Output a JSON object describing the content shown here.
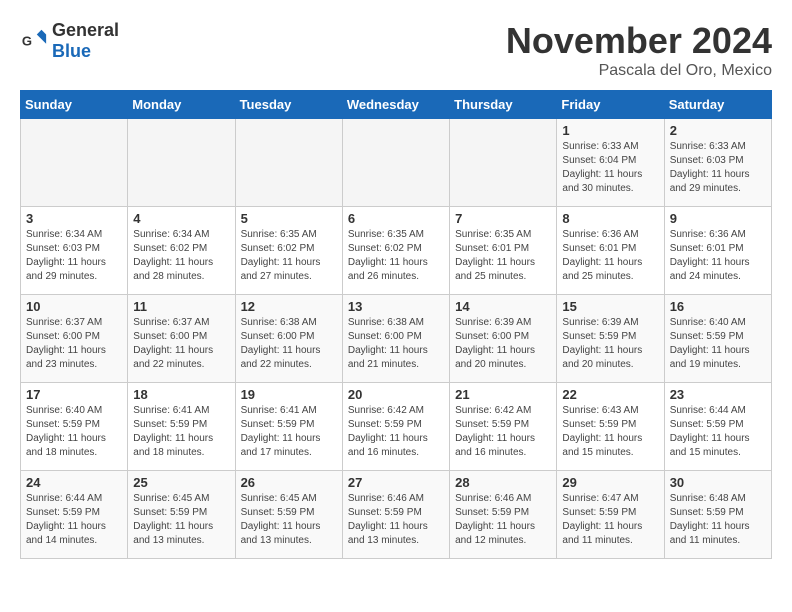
{
  "logo": {
    "general": "General",
    "blue": "Blue"
  },
  "title": "November 2024",
  "location": "Pascala del Oro, Mexico",
  "days_of_week": [
    "Sunday",
    "Monday",
    "Tuesday",
    "Wednesday",
    "Thursday",
    "Friday",
    "Saturday"
  ],
  "weeks": [
    [
      {
        "day": "",
        "info": ""
      },
      {
        "day": "",
        "info": ""
      },
      {
        "day": "",
        "info": ""
      },
      {
        "day": "",
        "info": ""
      },
      {
        "day": "",
        "info": ""
      },
      {
        "day": "1",
        "info": "Sunrise: 6:33 AM\nSunset: 6:04 PM\nDaylight: 11 hours and 30 minutes."
      },
      {
        "day": "2",
        "info": "Sunrise: 6:33 AM\nSunset: 6:03 PM\nDaylight: 11 hours and 29 minutes."
      }
    ],
    [
      {
        "day": "3",
        "info": "Sunrise: 6:34 AM\nSunset: 6:03 PM\nDaylight: 11 hours and 29 minutes."
      },
      {
        "day": "4",
        "info": "Sunrise: 6:34 AM\nSunset: 6:02 PM\nDaylight: 11 hours and 28 minutes."
      },
      {
        "day": "5",
        "info": "Sunrise: 6:35 AM\nSunset: 6:02 PM\nDaylight: 11 hours and 27 minutes."
      },
      {
        "day": "6",
        "info": "Sunrise: 6:35 AM\nSunset: 6:02 PM\nDaylight: 11 hours and 26 minutes."
      },
      {
        "day": "7",
        "info": "Sunrise: 6:35 AM\nSunset: 6:01 PM\nDaylight: 11 hours and 25 minutes."
      },
      {
        "day": "8",
        "info": "Sunrise: 6:36 AM\nSunset: 6:01 PM\nDaylight: 11 hours and 25 minutes."
      },
      {
        "day": "9",
        "info": "Sunrise: 6:36 AM\nSunset: 6:01 PM\nDaylight: 11 hours and 24 minutes."
      }
    ],
    [
      {
        "day": "10",
        "info": "Sunrise: 6:37 AM\nSunset: 6:00 PM\nDaylight: 11 hours and 23 minutes."
      },
      {
        "day": "11",
        "info": "Sunrise: 6:37 AM\nSunset: 6:00 PM\nDaylight: 11 hours and 22 minutes."
      },
      {
        "day": "12",
        "info": "Sunrise: 6:38 AM\nSunset: 6:00 PM\nDaylight: 11 hours and 22 minutes."
      },
      {
        "day": "13",
        "info": "Sunrise: 6:38 AM\nSunset: 6:00 PM\nDaylight: 11 hours and 21 minutes."
      },
      {
        "day": "14",
        "info": "Sunrise: 6:39 AM\nSunset: 6:00 PM\nDaylight: 11 hours and 20 minutes."
      },
      {
        "day": "15",
        "info": "Sunrise: 6:39 AM\nSunset: 5:59 PM\nDaylight: 11 hours and 20 minutes."
      },
      {
        "day": "16",
        "info": "Sunrise: 6:40 AM\nSunset: 5:59 PM\nDaylight: 11 hours and 19 minutes."
      }
    ],
    [
      {
        "day": "17",
        "info": "Sunrise: 6:40 AM\nSunset: 5:59 PM\nDaylight: 11 hours and 18 minutes."
      },
      {
        "day": "18",
        "info": "Sunrise: 6:41 AM\nSunset: 5:59 PM\nDaylight: 11 hours and 18 minutes."
      },
      {
        "day": "19",
        "info": "Sunrise: 6:41 AM\nSunset: 5:59 PM\nDaylight: 11 hours and 17 minutes."
      },
      {
        "day": "20",
        "info": "Sunrise: 6:42 AM\nSunset: 5:59 PM\nDaylight: 11 hours and 16 minutes."
      },
      {
        "day": "21",
        "info": "Sunrise: 6:42 AM\nSunset: 5:59 PM\nDaylight: 11 hours and 16 minutes."
      },
      {
        "day": "22",
        "info": "Sunrise: 6:43 AM\nSunset: 5:59 PM\nDaylight: 11 hours and 15 minutes."
      },
      {
        "day": "23",
        "info": "Sunrise: 6:44 AM\nSunset: 5:59 PM\nDaylight: 11 hours and 15 minutes."
      }
    ],
    [
      {
        "day": "24",
        "info": "Sunrise: 6:44 AM\nSunset: 5:59 PM\nDaylight: 11 hours and 14 minutes."
      },
      {
        "day": "25",
        "info": "Sunrise: 6:45 AM\nSunset: 5:59 PM\nDaylight: 11 hours and 13 minutes."
      },
      {
        "day": "26",
        "info": "Sunrise: 6:45 AM\nSunset: 5:59 PM\nDaylight: 11 hours and 13 minutes."
      },
      {
        "day": "27",
        "info": "Sunrise: 6:46 AM\nSunset: 5:59 PM\nDaylight: 11 hours and 13 minutes."
      },
      {
        "day": "28",
        "info": "Sunrise: 6:46 AM\nSunset: 5:59 PM\nDaylight: 11 hours and 12 minutes."
      },
      {
        "day": "29",
        "info": "Sunrise: 6:47 AM\nSunset: 5:59 PM\nDaylight: 11 hours and 11 minutes."
      },
      {
        "day": "30",
        "info": "Sunrise: 6:48 AM\nSunset: 5:59 PM\nDaylight: 11 hours and 11 minutes."
      }
    ]
  ]
}
